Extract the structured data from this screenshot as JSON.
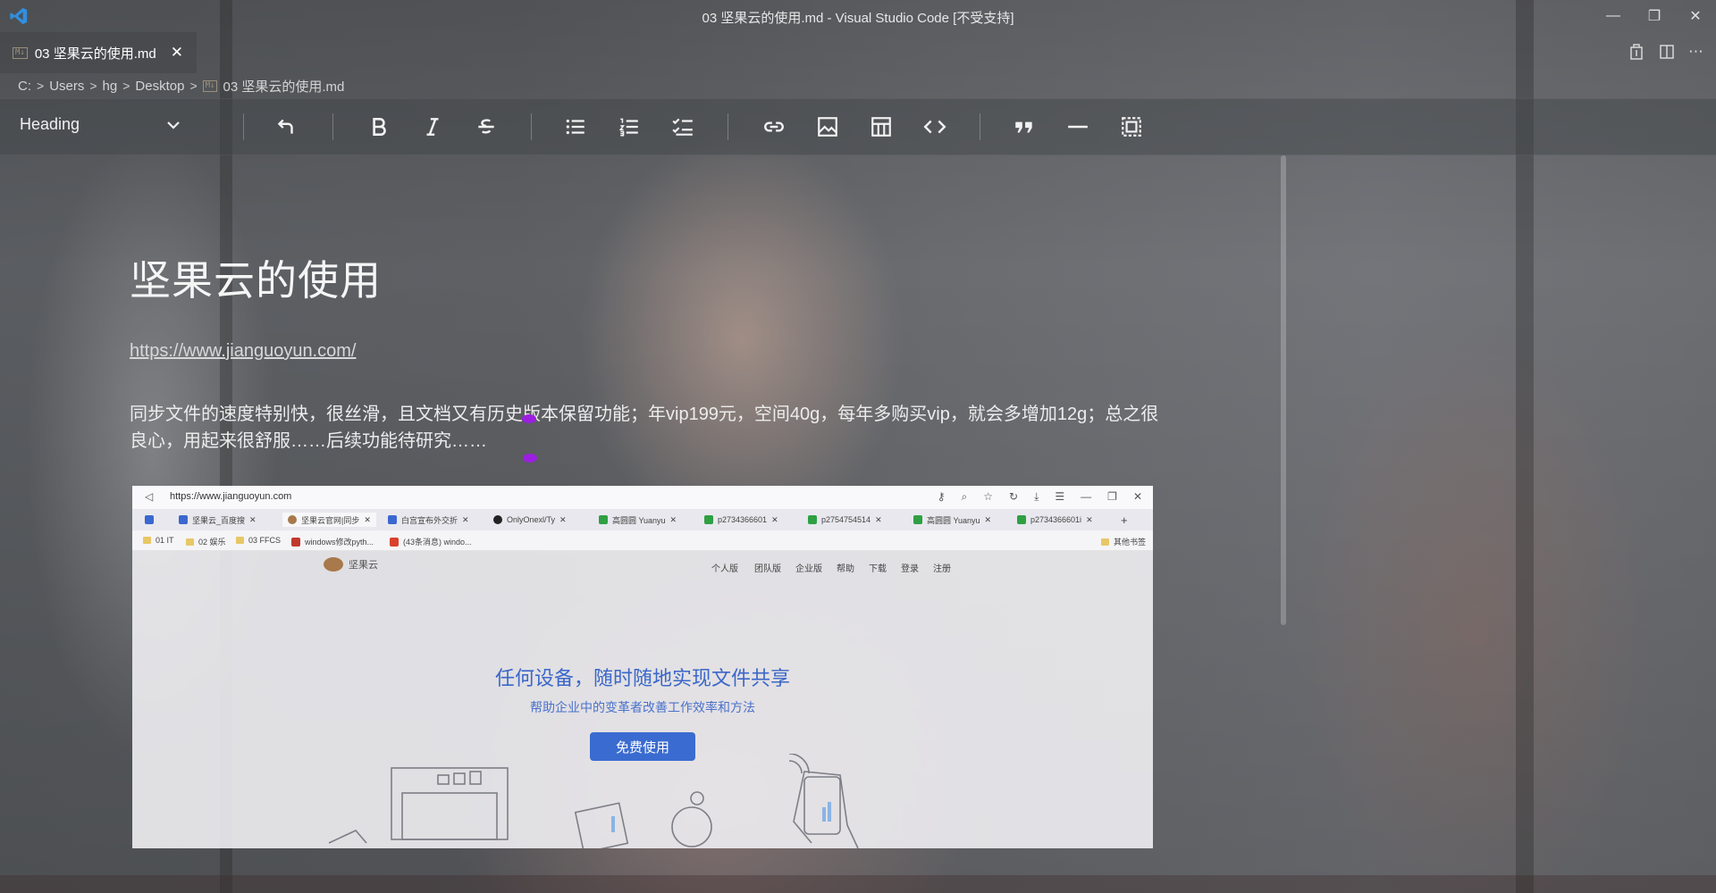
{
  "window": {
    "title": "03 坚果云的使用.md - Visual Studio Code [不受支持]"
  },
  "tab": {
    "badge": "M↓",
    "label": "03 坚果云的使用.md",
    "close": "✕"
  },
  "breadcrumb": {
    "items": [
      "C:",
      "Users",
      "hg",
      "Desktop",
      "03 坚果云的使用.md"
    ],
    "separator": ">"
  },
  "toolbar": {
    "heading_label": "Heading"
  },
  "document": {
    "title": "坚果云的使用",
    "link": "https://www.jianguoyun.com/",
    "paragraph": "同步文件的速度特别快，很丝滑，且文档又有历史版本保留功能；年vip199元，空间40g，每年多购买vip，就会多增加12g；总之很良心，用起来很舒服……后续功能待研究……"
  },
  "screenshot": {
    "url": "https://www.jianguoyun.com",
    "tabs": [
      "坚果云_百度搜",
      "坚果云官网|同步",
      "白宫宣布外交折",
      "OnlyOnexl/Ty",
      "高圆圆 Yuanyu",
      "p2734366601",
      "p2754754514",
      "高圆圆 Yuanyu",
      "p2734366601i"
    ],
    "bookmarks": [
      "01 IT",
      "02 娱乐",
      "03 FFCS",
      "windows修改pyth...",
      "(43条消息) windo...",
      "其他书签"
    ],
    "logo_text": "坚果云",
    "nav": [
      "个人版",
      "团队版",
      "企业版",
      "帮助",
      "下载",
      "登录",
      "注册"
    ],
    "hero_title": "任何设备，随时随地实现文件共享",
    "hero_subtitle": "帮助企业中的变革者改善工作效率和方法",
    "hero_button": "免费使用"
  },
  "colors": {
    "cursor_marker": "#9b1fe0",
    "hero_blue": "#3a6bd0",
    "vscode_blue": "#2f8fe0"
  }
}
